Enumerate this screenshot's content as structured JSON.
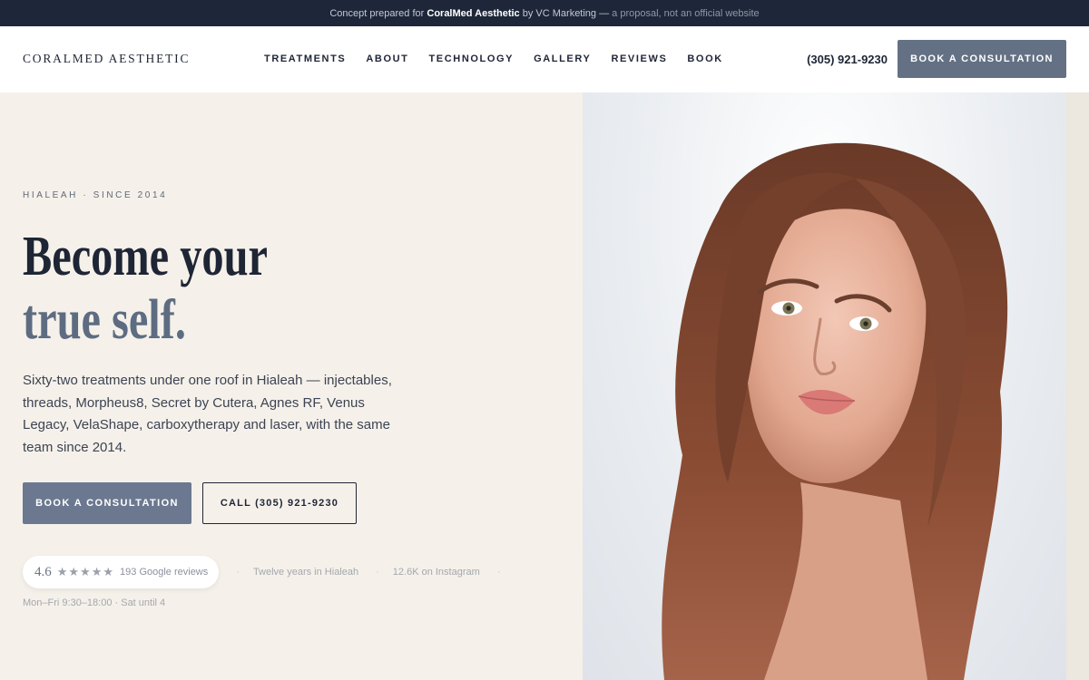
{
  "banner": {
    "prefix": "Concept prepared for",
    "brand": "CoralMed Aesthetic",
    "middle": "by VC Marketing —",
    "suffix": "a proposal, not an official website"
  },
  "header": {
    "logo": "CORALMED AESTHETIC",
    "nav": [
      "TREATMENTS",
      "ABOUT",
      "TECHNOLOGY",
      "GALLERY",
      "REVIEWS",
      "BOOK"
    ],
    "phone": "(305) 921-9230",
    "cta": "BOOK A CONSULTATION"
  },
  "hero": {
    "eyebrow": "HIALEAH · SINCE 2014",
    "headline_line1": "Become your",
    "headline_line2": "true self.",
    "lede": "Sixty-two treatments under one roof in Hialeah — injectables, threads, Morpheus8, Secret by Cutera, Agnes RF, Venus Legacy, VelaShape, carboxytherapy and laser, with the same team since 2014.",
    "primary_cta": "BOOK A CONSULTATION",
    "secondary_cta": "CALL (305) 921-9230",
    "rating": "4.6",
    "stars": "★★★★★",
    "reviews": "193 Google reviews",
    "proof_years": "Twelve years in Hialeah",
    "proof_instagram": "12.6K on Instagram",
    "hours": "Mon–Fri 9:30–18:00 · Sat until 4"
  },
  "colors": {
    "navy": "#1e2739",
    "slate_accent": "#647184",
    "cream_background": "#f5f1ea"
  }
}
